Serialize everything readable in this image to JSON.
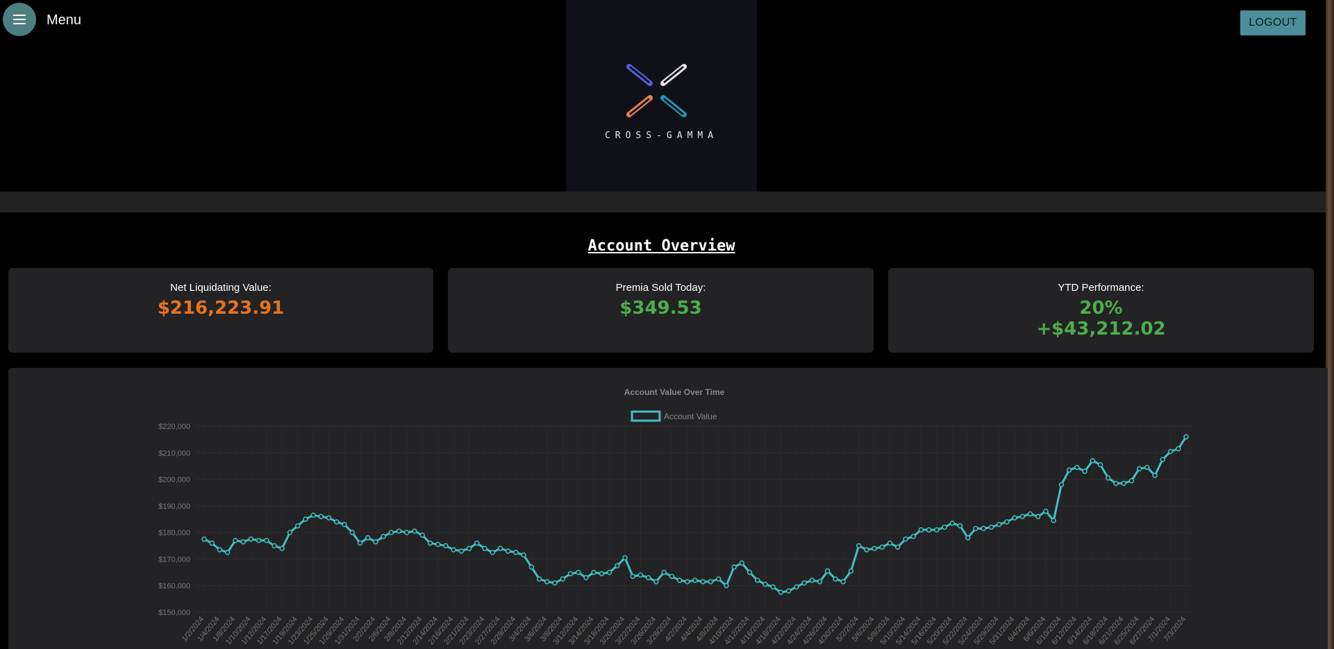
{
  "header": {
    "menu_label": "Menu",
    "logout_label": "LOGOUT",
    "logo_text": "CROSS-GAMMA"
  },
  "overview": {
    "title": "Account Overview",
    "cards": [
      {
        "label": "Net Liquidating Value:",
        "value": "$216,223.91",
        "color": "#e8731e"
      },
      {
        "label": "Premia Sold Today:",
        "value": "$349.53",
        "color": "#4cae4c"
      },
      {
        "label": "YTD Performance:",
        "value": "20%",
        "value2": "+$43,212.02",
        "color": "#4cae4c"
      }
    ]
  },
  "colors": {
    "line": "#3ec3c6",
    "accent_button": "#4d8f98",
    "logo_blue": "#4f5fe0",
    "logo_white": "#e6e6e6",
    "logo_orange": "#e8824a",
    "logo_teal": "#1f9ab3"
  },
  "chart_data": {
    "type": "line",
    "title": "Account Value Over Time",
    "legend": [
      "Account Value"
    ],
    "legend_position": "top",
    "ylim": [
      150000,
      220000
    ],
    "y_ticks": [
      "$150,000",
      "$160,000",
      "$170,000",
      "$180,000",
      "$190,000",
      "$200,000",
      "$210,000",
      "$220,000"
    ],
    "x_tick_labels": [
      "1/2/2024",
      "1/4/2024",
      "1/8/2024",
      "1/10/2024",
      "1/12/2024",
      "1/17/2024",
      "1/19/2024",
      "1/23/2024",
      "1/25/2024",
      "1/29/2024",
      "1/31/2024",
      "2/2/2024",
      "2/6/2024",
      "2/8/2024",
      "2/12/2024",
      "2/14/2024",
      "2/16/2024",
      "2/21/2024",
      "2/23/2024",
      "2/27/2024",
      "2/29/2024",
      "3/4/2024",
      "3/6/2024",
      "3/8/2024",
      "3/12/2024",
      "3/14/2024",
      "3/18/2024",
      "3/20/2024",
      "3/22/2024",
      "3/26/2024",
      "3/28/2024",
      "4/2/2024",
      "4/4/2024",
      "4/8/2024",
      "4/10/2024",
      "4/12/2024",
      "4/16/2024",
      "4/18/2024",
      "4/22/2024",
      "4/24/2024",
      "4/26/2024",
      "4/30/2024",
      "5/2/2024",
      "5/6/2024",
      "5/8/2024",
      "5/10/2024",
      "5/14/2024",
      "5/16/2024",
      "5/20/2024",
      "5/22/2024",
      "5/24/2024",
      "5/29/2024",
      "5/31/2024",
      "6/4/2024",
      "6/6/2024",
      "6/10/2024",
      "6/12/2024",
      "6/14/2024",
      "6/18/2024",
      "6/21/2024",
      "6/25/2024",
      "6/27/2024",
      "7/1/2024",
      "7/3/2024"
    ],
    "series": [
      {
        "name": "Account Value",
        "values": [
          177500,
          176000,
          173500,
          172500,
          177000,
          176500,
          177500,
          177000,
          177000,
          175000,
          174000,
          180000,
          182500,
          185000,
          186500,
          186000,
          185500,
          184000,
          183000,
          180000,
          176000,
          178000,
          176500,
          178500,
          180000,
          180500,
          180000,
          180500,
          179000,
          176000,
          175500,
          175000,
          173500,
          173000,
          174000,
          176000,
          174000,
          172500,
          174000,
          173000,
          172500,
          171500,
          167000,
          162500,
          161500,
          161000,
          162500,
          164500,
          165000,
          163000,
          165000,
          164500,
          165000,
          167500,
          170500,
          163500,
          164000,
          163000,
          161500,
          165000,
          163500,
          162000,
          161500,
          162000,
          161500,
          161500,
          162500,
          160000,
          167000,
          168500,
          165000,
          162000,
          160500,
          159500,
          157500,
          158000,
          159500,
          161000,
          162000,
          161500,
          165500,
          162500,
          161500,
          165500,
          175000,
          173500,
          174000,
          174500,
          176000,
          174500,
          177500,
          178500,
          181000,
          181000,
          181000,
          182000,
          183500,
          182500,
          178000,
          181500,
          181500,
          182000,
          183000,
          184000,
          185500,
          186000,
          187000,
          186000,
          188000,
          184500,
          198000,
          203500,
          204500,
          203000,
          207000,
          205500,
          200500,
          198500,
          198500,
          199500,
          204000,
          204500,
          201500,
          207500,
          210500,
          211500,
          216000
        ]
      }
    ]
  }
}
